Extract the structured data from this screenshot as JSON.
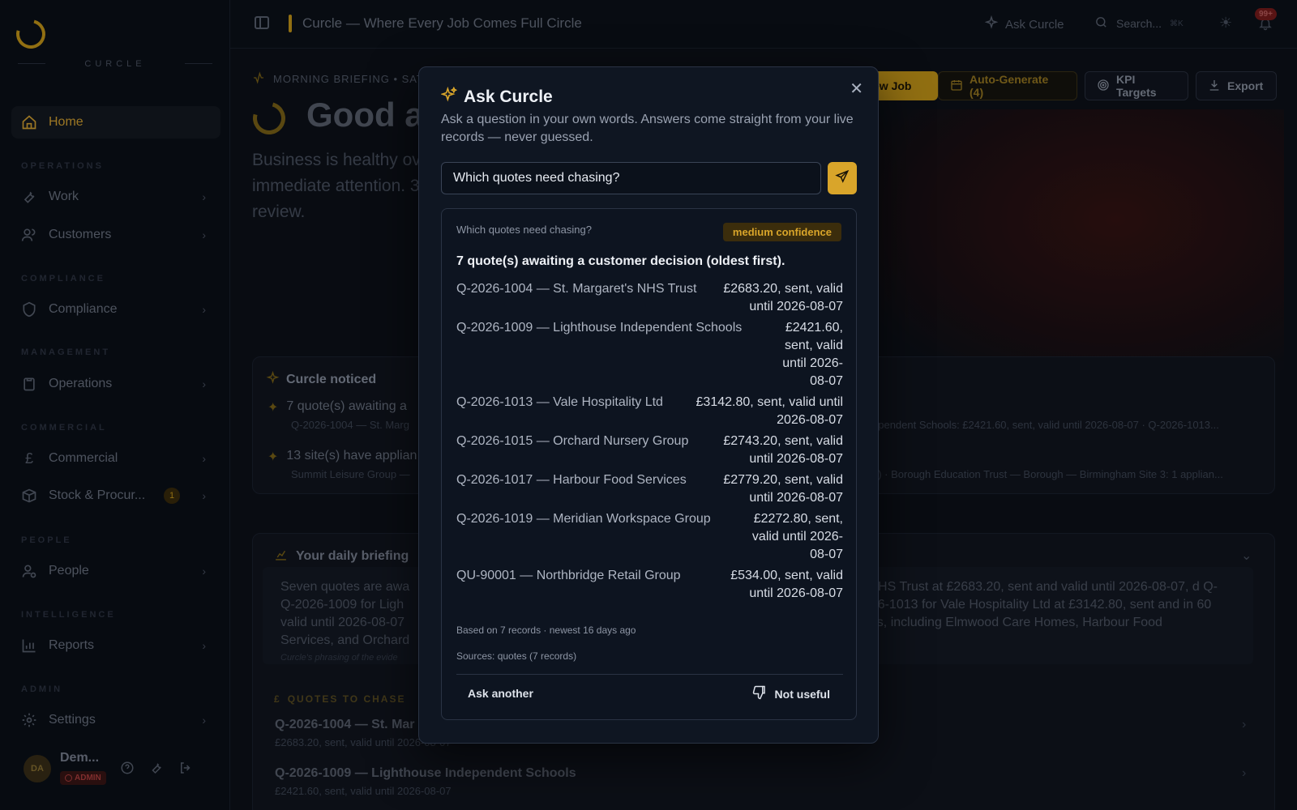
{
  "app": {
    "logo_word": "CURCLE",
    "title": "Curcle — Where Every Job Comes Full Circle",
    "ask_label": "Ask Curcle",
    "search_placeholder": "Search...",
    "search_kbd": "⌘K",
    "notifications_badge": "99+"
  },
  "sidebar": {
    "home": "Home",
    "sections": {
      "operations": "OPERATIONS",
      "compliance": "COMPLIANCE",
      "management": "MANAGEMENT",
      "commercial": "COMMERCIAL",
      "people": "PEOPLE",
      "intelligence": "INTELLIGENCE",
      "admin": "ADMIN"
    },
    "items": {
      "work": "Work",
      "customers": "Customers",
      "compliance": "Compliance",
      "operations": "Operations",
      "commercial": "Commercial",
      "stock": "Stock & Procur...",
      "stock_badge": "1",
      "people": "People",
      "reports": "Reports",
      "settings": "Settings"
    },
    "user": {
      "initials": "DA",
      "name": "Dem...",
      "role": "ADMIN"
    }
  },
  "main": {
    "briefing_label": "MORNING BRIEFING • SAT",
    "greeting": "Good af",
    "summary": "Business is healthy ov immediate attention. 3 review.",
    "buttons": {
      "new_job": "ew Job",
      "auto_generate": "Auto-Generate (4)",
      "kpi": "KPI Targets",
      "export": "Export"
    },
    "noticed": {
      "title": "Curcle noticed",
      "items": [
        {
          "text": "7 quote(s) awaiting a",
          "sub": "Q-2026-1004 — St. Marg",
          "sub_right": "ependent Schools: £2421.60, sent, valid until 2026-08-07 · Q-2026-1013..."
        },
        {
          "text": "13 site(s) have applian",
          "sub": "Summit Leisure Group —",
          "sub_right": "d) · Borough Education Trust — Borough — Birmingham Site 3: 1 applian..."
        }
      ]
    },
    "daily": {
      "title": "Your daily briefing",
      "text_left": "Seven quotes are awa Q-2026-1009 for Ligh valid until 2026-08-07 Services, and Orchard",
      "text_right": "'s NHS Trust at £2683.20, sent and valid until 2026-08-07, d Q-2026-1013 for Vale Hospitality Ltd at £3142.80, sent and in 60 days, including Elmwood Care Homes, Harbour Food",
      "note": "Curcle's phrasing of the evide",
      "chase_label": "QUOTES TO CHASE",
      "rows": [
        {
          "title": "Q-2026-1004 — St. Mar",
          "sub": "£2683.20, sent, valid until 2026-08-07"
        },
        {
          "title": "Q-2026-1009 — Lighthouse Independent Schools",
          "sub": "£2421.60, sent, valid until 2026-08-07"
        }
      ]
    }
  },
  "modal": {
    "title": "Ask Curcle",
    "description": "Ask a question in your own words. Answers come straight from your live records — never guessed.",
    "input_value": "Which quotes need chasing?",
    "answer": {
      "question": "Which quotes need chasing?",
      "confidence": "medium confidence",
      "summary": "7 quote(s) awaiting a customer decision (oldest first).",
      "rows": [
        {
          "name": "Q-2026-1004 — St. Margaret's NHS Trust",
          "value": "£2683.20, sent, valid until 2026-08-07"
        },
        {
          "name": "Q-2026-1009 — Lighthouse Independent Schools",
          "value": "£2421.60, sent, valid until 2026-08-07"
        },
        {
          "name": "Q-2026-1013 — Vale Hospitality Ltd",
          "value": "£3142.80, sent, valid until 2026-08-07"
        },
        {
          "name": "Q-2026-1015 — Orchard Nursery Group",
          "value": "£2743.20, sent, valid until 2026-08-07"
        },
        {
          "name": "Q-2026-1017 — Harbour Food Services",
          "value": "£2779.20, sent, valid until 2026-08-07"
        },
        {
          "name": "Q-2026-1019 — Meridian Workspace Group",
          "value": "£2272.80, sent, valid until 2026-08-07"
        },
        {
          "name": "QU-90001 — Northbridge Retail Group",
          "value": "£534.00, sent, valid until 2026-08-07"
        }
      ],
      "meta": "Based on 7 records · newest 16 days ago",
      "sources": "Sources: quotes (7 records)",
      "ask_another": "Ask another",
      "not_useful": "Not useful"
    }
  },
  "colors": {
    "accent": "#d9a52a",
    "background": "#0d1119",
    "modal": "#0f1622"
  }
}
